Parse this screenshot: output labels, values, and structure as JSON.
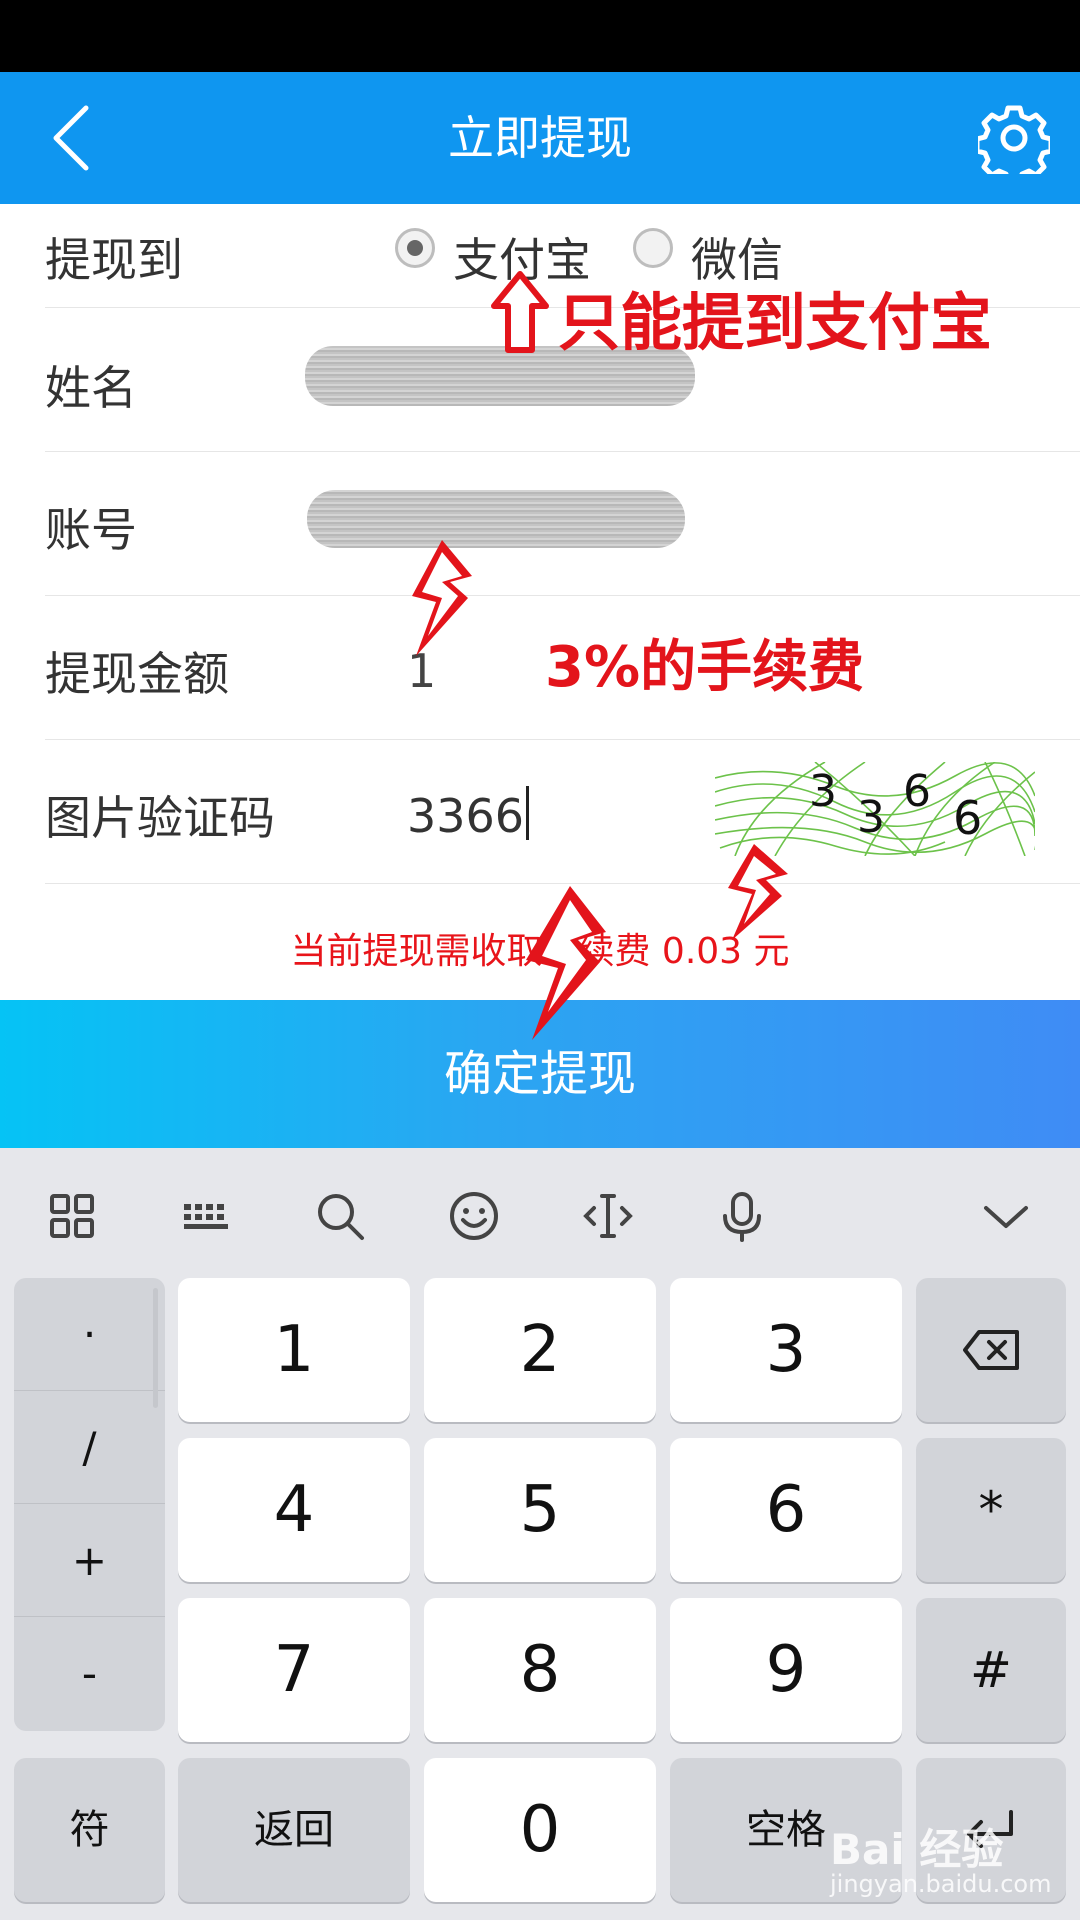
{
  "header": {
    "title": "立即提现"
  },
  "form": {
    "withdraw_to_label": "提现到",
    "option_alipay": "支付宝",
    "option_wechat": "微信",
    "name_label": "姓名",
    "account_label": "账号",
    "amount_label": "提现金额",
    "amount_value": "1",
    "captcha_label": "图片验证码",
    "captcha_value": "3366",
    "captcha_image_text": [
      "3",
      "3",
      "6",
      "6"
    ],
    "fee_text": "当前提现需收取手续费 0.03 元",
    "confirm_label": "确定提现"
  },
  "annotations": {
    "alipay_only": "只能提到支付宝",
    "fee_rate": "3%的手续费"
  },
  "keyboard": {
    "side_keys": [
      "·",
      "/",
      "+",
      "-"
    ],
    "digits": [
      "1",
      "2",
      "3",
      "4",
      "5",
      "6",
      "7",
      "8",
      "9",
      "0"
    ],
    "symbols": {
      "star": "*",
      "hash": "#"
    },
    "bottom": {
      "symbols_key": "符",
      "back_key": "返回",
      "space_key": "空格"
    }
  },
  "watermark": {
    "brand": "Bai 经验",
    "url": "jingyan.baidu.com"
  },
  "colors": {
    "header": "#0f96f0",
    "annotation": "#e3141b",
    "fee_text": "#e8141a"
  }
}
